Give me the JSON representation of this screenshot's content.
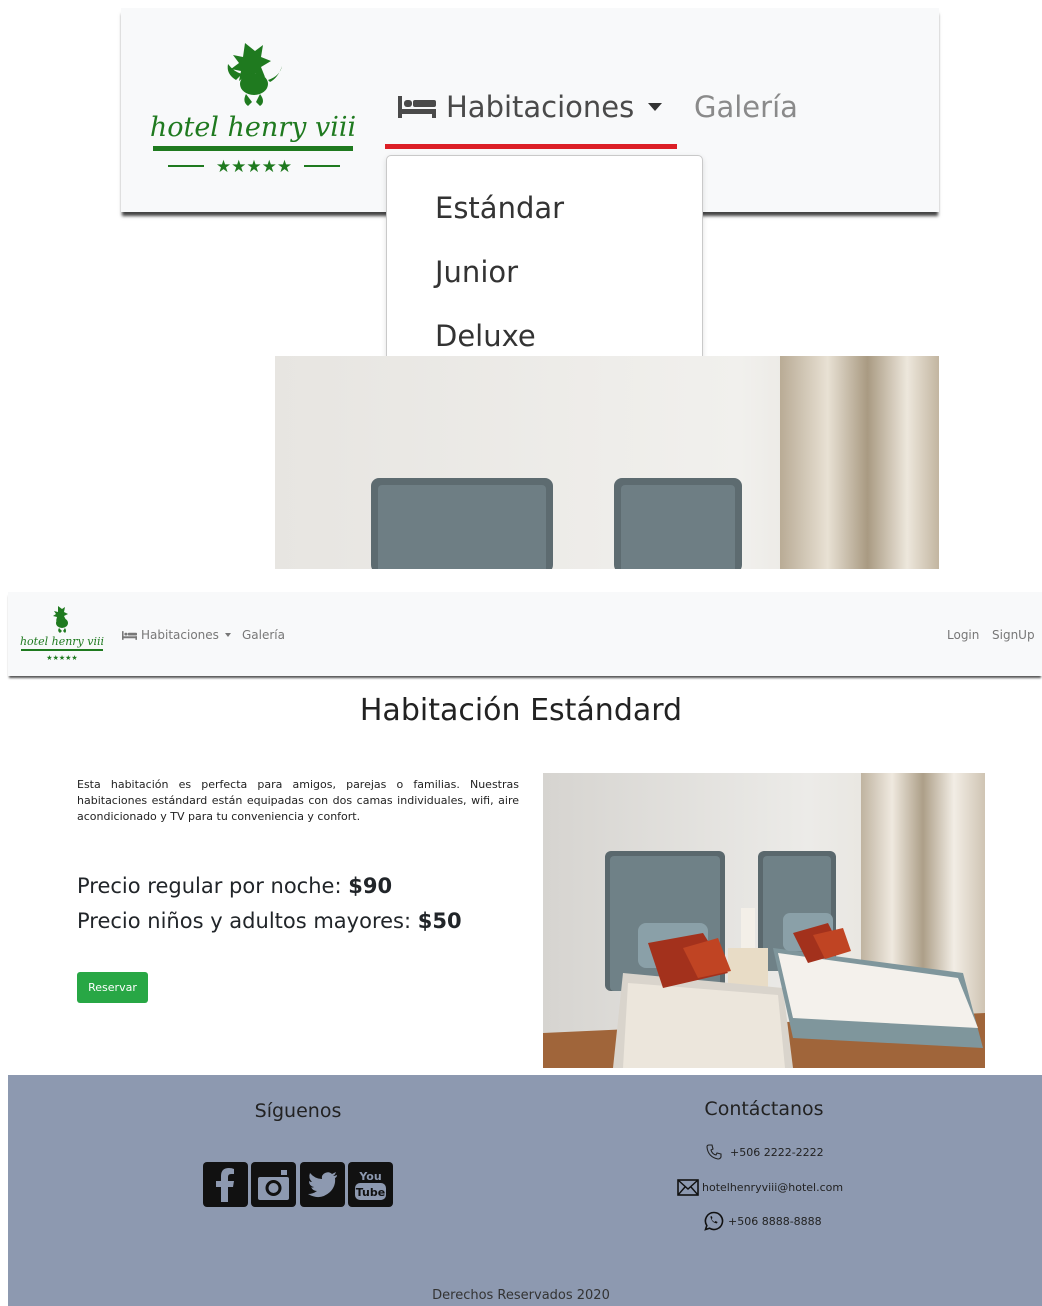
{
  "brand": {
    "logo_line1": "hotel henry viii",
    "logo_stars": "★★★★★"
  },
  "zoom": {
    "habitaciones_label": "Habitaciones",
    "galeria_label": "Galería",
    "dropdown": [
      "Estándar",
      "Junior",
      "Deluxe"
    ]
  },
  "nav": {
    "habitaciones_label": "Habitaciones",
    "galeria_label": "Galería",
    "login_label": "Login",
    "signup_label": "SignUp"
  },
  "main": {
    "title": "Habitación Estándard",
    "description": "Esta habitación es perfecta para amigos, parejas o familias. Nuestras habitaciones estándard están equipadas con dos camas individuales, wifi, aire acondicionado y TV para tu conveniencia y confort.",
    "price_regular_label": "Precio regular por noche: ",
    "price_regular_value": "$90",
    "price_senior_label": "Precio niños y adultos mayores: ",
    "price_senior_value": "$50",
    "reserve_label": "Reservar"
  },
  "footer": {
    "follow_title": "Síguenos",
    "social": [
      "facebook-icon",
      "instagram-icon",
      "twitter-icon",
      "youtube-icon"
    ],
    "youtube_text_top": "You",
    "youtube_text_bottom": "Tube",
    "contact_title": "Contáctanos",
    "phone": "+506 2222-2222",
    "email": "hotelhenryviii@hotel.com",
    "whatsapp": "+506 8888-8888",
    "copyright": "Derechos Reservados 2020"
  },
  "colors": {
    "brand_green": "#1f7a1f",
    "accent_red": "#dc1f26",
    "button_green": "#28a745",
    "footer_bg": "#8d99b0"
  }
}
